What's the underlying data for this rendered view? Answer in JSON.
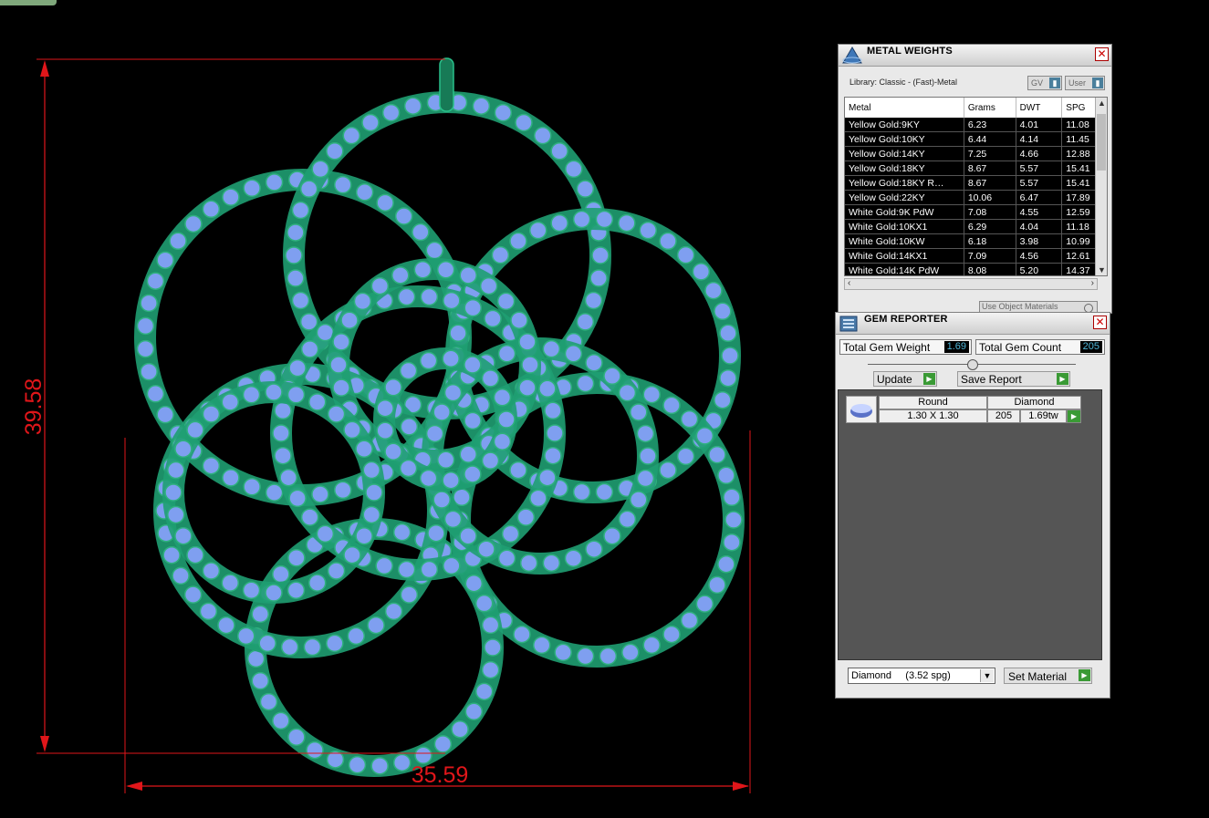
{
  "dimensions": {
    "height_label": "39.58",
    "width_label": "35.59",
    "line_color": "#e0161a"
  },
  "model": {
    "metal_color": "#1f9e72",
    "gem_color": "#7f9ff0"
  },
  "metal_weights": {
    "title": "METAL WEIGHTS",
    "library_label": "Library: Classic - (Fast)-Metal",
    "toggle_gv": "GV",
    "toggle_user": "User",
    "columns": [
      "Metal",
      "Grams",
      "DWT",
      "SPG"
    ],
    "rows": [
      [
        "Yellow Gold:9KY",
        "6.23",
        "4.01",
        "11.08"
      ],
      [
        "Yellow Gold:10KY",
        "6.44",
        "4.14",
        "11.45"
      ],
      [
        "Yellow Gold:14KY",
        "7.25",
        "4.66",
        "12.88"
      ],
      [
        "Yellow Gold:18KY",
        "8.67",
        "5.57",
        "15.41"
      ],
      [
        "Yellow Gold:18KY R…",
        "8.67",
        "5.57",
        "15.41"
      ],
      [
        "Yellow Gold:22KY",
        "10.06",
        "6.47",
        "17.89"
      ],
      [
        "White Gold:9K PdW",
        "7.08",
        "4.55",
        "12.59"
      ],
      [
        "White Gold:10KX1",
        "6.29",
        "4.04",
        "11.18"
      ],
      [
        "White Gold:10KW",
        "6.18",
        "3.98",
        "10.99"
      ],
      [
        "White Gold:14KX1",
        "7.09",
        "4.56",
        "12.61"
      ],
      [
        "White Gold:14K PdW",
        "8.08",
        "5.20",
        "14.37"
      ]
    ],
    "use_object_materials": "Use Object Materials"
  },
  "gem_reporter": {
    "title": "GEM REPORTER",
    "total_weight_label": "Total Gem Weight",
    "total_weight_value": "1.69",
    "total_count_label": "Total Gem Count",
    "total_count_value": "205",
    "update_label": "Update",
    "save_report_label": "Save Report",
    "gem_entry": {
      "shape": "Round",
      "material": "Diamond",
      "size": "1.30 X 1.30",
      "count": "205",
      "weight": "1.69tw"
    },
    "material_select": "Diamond     (3.52 spg)",
    "set_material_label": "Set Material"
  }
}
